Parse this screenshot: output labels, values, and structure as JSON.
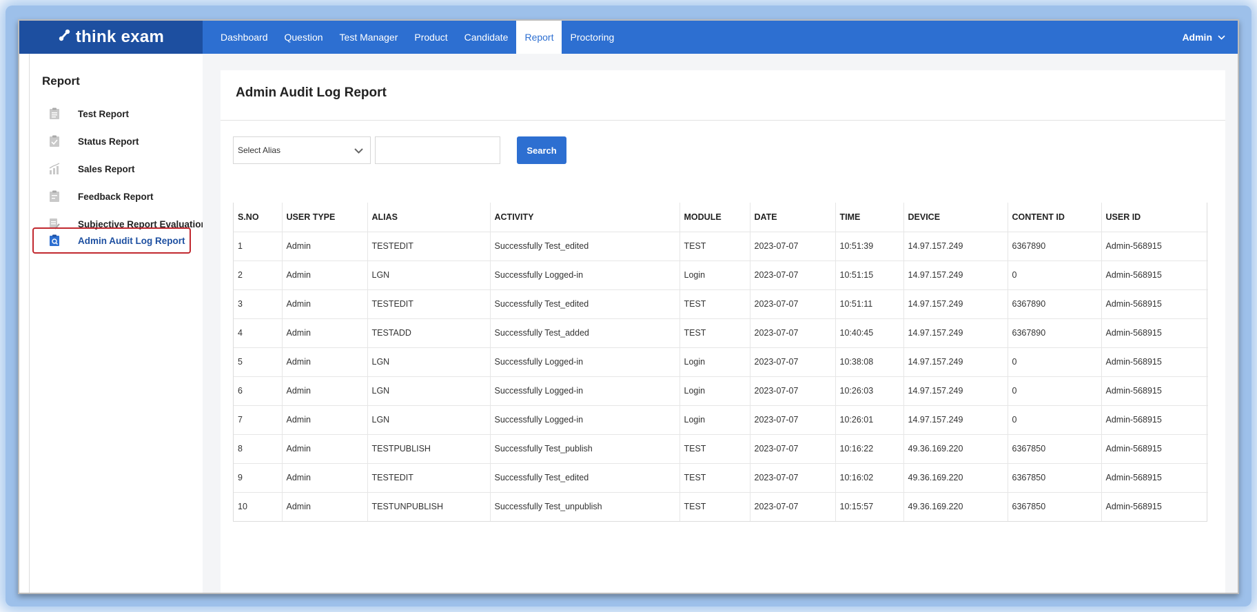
{
  "app": {
    "brand": "think exam"
  },
  "nav": {
    "items": [
      {
        "label": "Dashboard"
      },
      {
        "label": "Question"
      },
      {
        "label": "Test Manager"
      },
      {
        "label": "Product"
      },
      {
        "label": "Candidate"
      },
      {
        "label": "Report",
        "active": true
      },
      {
        "label": "Proctoring"
      }
    ],
    "user_label": "Admin"
  },
  "sidebar": {
    "title": "Report",
    "items": [
      {
        "label": "Test Report",
        "icon": "clipboard-icon"
      },
      {
        "label": "Status Report",
        "icon": "clipboard-check-icon"
      },
      {
        "label": "Sales Report",
        "icon": "bar-chart-icon"
      },
      {
        "label": "Feedback Report",
        "icon": "clipboard-feedback-icon"
      },
      {
        "label": "Subjective Report Evaluation",
        "icon": "edit-document-icon"
      },
      {
        "label": "Admin Audit Log Report",
        "icon": "clipboard-search-icon",
        "active": true
      }
    ]
  },
  "main": {
    "title": "Admin Audit Log Report",
    "filter": {
      "alias_select_value": "Select Alias",
      "search_value": "",
      "search_button": "Search"
    },
    "table": {
      "columns": [
        "S.NO",
        "USER TYPE",
        "ALIAS",
        "ACTIVITY",
        "MODULE",
        "DATE",
        "TIME",
        "DEVICE",
        "CONTENT ID",
        "USER ID"
      ],
      "rows": [
        [
          "1",
          "Admin",
          "TESTEDIT",
          "Successfully Test_edited",
          "TEST",
          "2023-07-07",
          "10:51:39",
          "14.97.157.249",
          "6367890",
          "Admin-568915"
        ],
        [
          "2",
          "Admin",
          "LGN",
          "Successfully Logged-in",
          "Login",
          "2023-07-07",
          "10:51:15",
          "14.97.157.249",
          "0",
          "Admin-568915"
        ],
        [
          "3",
          "Admin",
          "TESTEDIT",
          "Successfully Test_edited",
          "TEST",
          "2023-07-07",
          "10:51:11",
          "14.97.157.249",
          "6367890",
          "Admin-568915"
        ],
        [
          "4",
          "Admin",
          "TESTADD",
          "Successfully Test_added",
          "TEST",
          "2023-07-07",
          "10:40:45",
          "14.97.157.249",
          "6367890",
          "Admin-568915"
        ],
        [
          "5",
          "Admin",
          "LGN",
          "Successfully Logged-in",
          "Login",
          "2023-07-07",
          "10:38:08",
          "14.97.157.249",
          "0",
          "Admin-568915"
        ],
        [
          "6",
          "Admin",
          "LGN",
          "Successfully Logged-in",
          "Login",
          "2023-07-07",
          "10:26:03",
          "14.97.157.249",
          "0",
          "Admin-568915"
        ],
        [
          "7",
          "Admin",
          "LGN",
          "Successfully Logged-in",
          "Login",
          "2023-07-07",
          "10:26:01",
          "14.97.157.249",
          "0",
          "Admin-568915"
        ],
        [
          "8",
          "Admin",
          "TESTPUBLISH",
          "Successfully Test_publish",
          "TEST",
          "2023-07-07",
          "10:16:22",
          "49.36.169.220",
          "6367850",
          "Admin-568915"
        ],
        [
          "9",
          "Admin",
          "TESTEDIT",
          "Successfully Test_edited",
          "TEST",
          "2023-07-07",
          "10:16:02",
          "49.36.169.220",
          "6367850",
          "Admin-568915"
        ],
        [
          "10",
          "Admin",
          "TESTUNPUBLISH",
          "Successfully Test_unpublish",
          "TEST",
          "2023-07-07",
          "10:15:57",
          "49.36.169.220",
          "6367850",
          "Admin-568915"
        ]
      ]
    }
  },
  "colors": {
    "nav_blue": "#2d6fd1",
    "brand_blue": "#1d4fa0",
    "active_outline": "#c1282f"
  }
}
